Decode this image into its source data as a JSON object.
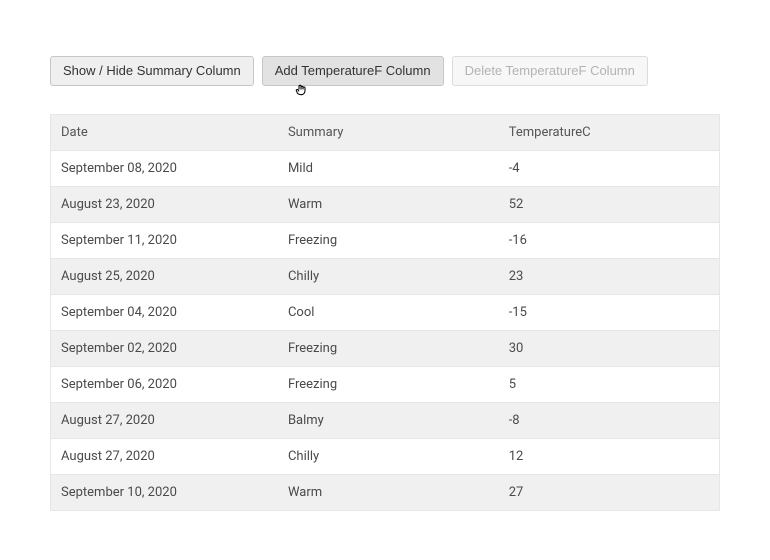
{
  "buttons": {
    "toggle_summary": "Show / Hide Summary Column",
    "add_tempf": "Add TemperatureF Column",
    "delete_tempf": "Delete TemperatureF Column"
  },
  "table": {
    "headers": [
      "Date",
      "Summary",
      "TemperatureC"
    ],
    "rows": [
      {
        "date": "September 08, 2020",
        "summary": "Mild",
        "tempc": "-4"
      },
      {
        "date": "August 23, 2020",
        "summary": "Warm",
        "tempc": "52"
      },
      {
        "date": "September 11, 2020",
        "summary": "Freezing",
        "tempc": "-16"
      },
      {
        "date": "August 25, 2020",
        "summary": "Chilly",
        "tempc": "23"
      },
      {
        "date": "September 04, 2020",
        "summary": "Cool",
        "tempc": "-15"
      },
      {
        "date": "September 02, 2020",
        "summary": "Freezing",
        "tempc": "30"
      },
      {
        "date": "September 06, 2020",
        "summary": "Freezing",
        "tempc": "5"
      },
      {
        "date": "August 27, 2020",
        "summary": "Balmy",
        "tempc": "-8"
      },
      {
        "date": "August 27, 2020",
        "summary": "Chilly",
        "tempc": "12"
      },
      {
        "date": "September 10, 2020",
        "summary": "Warm",
        "tempc": "27"
      }
    ]
  }
}
